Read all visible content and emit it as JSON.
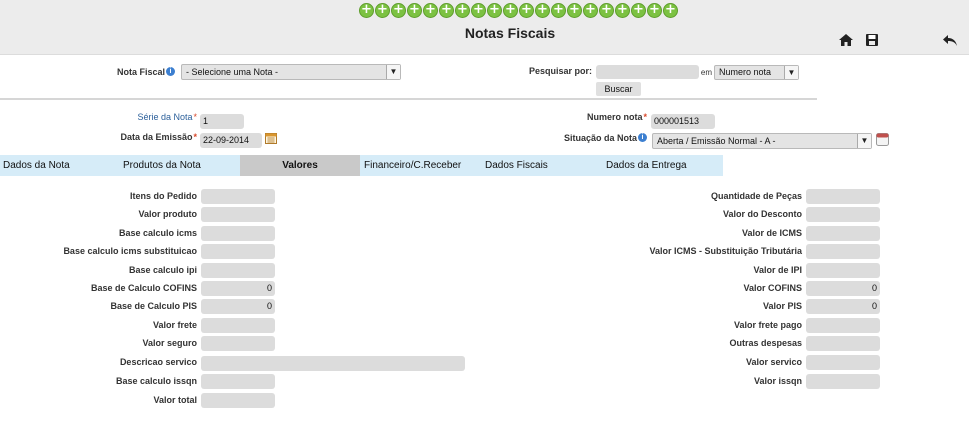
{
  "header": {
    "title": "Notas Fiscais",
    "plus_buttons": [
      "+",
      "+",
      "+",
      "+",
      "+",
      "+",
      "+",
      "+",
      "+",
      "+",
      "+",
      "+",
      "+",
      "+",
      "+",
      "+",
      "+",
      "+",
      "+",
      "+"
    ],
    "icons": [
      "home-icon",
      "save-icon",
      "back-icon"
    ]
  },
  "search": {
    "nota_fiscal_label": "Nota Fiscal",
    "nota_select_value": "- Selecione uma Nota -",
    "pesquisar_label": "Pesquisar por:",
    "search_value": "",
    "em_label": "em",
    "search_field_value": "Numero nota",
    "buscar_label": "Buscar"
  },
  "form": {
    "serie_label": "Série da Nota",
    "serie_value": "1",
    "data_label": "Data da Emissão",
    "data_value": "22-09-2014",
    "numero_label": "Numero nota",
    "numero_value": "000001513",
    "situacao_label": "Situação da Nota",
    "situacao_value": "Aberta / Emissão Normal - A -"
  },
  "tabs": [
    {
      "label": "Dados da Nota"
    },
    {
      "label": "Produtos da Nota"
    },
    {
      "label": "Valores"
    },
    {
      "label": "Financeiro/C.Receber"
    },
    {
      "label": "Dados Fiscais"
    },
    {
      "label": "Dados da Entrega"
    }
  ],
  "left_fields": [
    {
      "label": "Itens do Pedido",
      "value": ""
    },
    {
      "label": "Valor produto",
      "value": ""
    },
    {
      "label": "Base calculo icms",
      "value": ""
    },
    {
      "label": "Base calculo icms substituicao",
      "value": ""
    },
    {
      "label": "Base calculo ipi",
      "value": ""
    },
    {
      "label": "Base de Calculo COFINS",
      "value": "0"
    },
    {
      "label": "Base de Calculo PIS",
      "value": "0"
    },
    {
      "label": "Valor frete",
      "value": ""
    },
    {
      "label": "Valor seguro",
      "value": ""
    },
    {
      "label": "Descricao servico",
      "value": ""
    },
    {
      "label": "Base calculo issqn",
      "value": ""
    },
    {
      "label": "Valor total",
      "value": ""
    }
  ],
  "right_fields": [
    {
      "label": "Quantidade de Peças",
      "value": ""
    },
    {
      "label": "Valor do Desconto",
      "value": ""
    },
    {
      "label": "Valor de ICMS",
      "value": ""
    },
    {
      "label": "Valor ICMS - Substituição Tributária",
      "value": ""
    },
    {
      "label": "Valor de IPI",
      "value": ""
    },
    {
      "label": "Valor COFINS",
      "value": "0"
    },
    {
      "label": "Valor PIS",
      "value": "0"
    },
    {
      "label": "Valor frete pago",
      "value": ""
    },
    {
      "label": "Outras despesas",
      "value": ""
    },
    {
      "label": "Valor servico",
      "value": ""
    },
    {
      "label": "Valor issqn",
      "value": ""
    }
  ]
}
